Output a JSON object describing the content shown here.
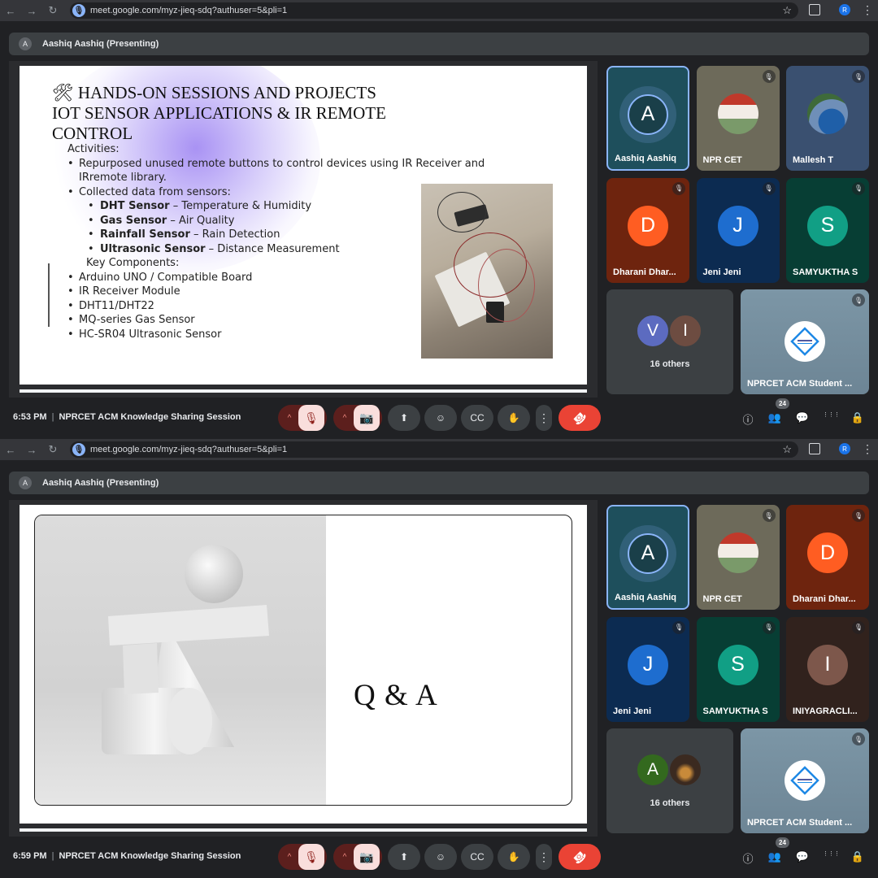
{
  "browser": {
    "url": "meet.google.com/myz-jieq-sdq?authuser=5&pli=1",
    "profile_initial": "R",
    "back_glyph": "←",
    "forward_glyph": "→",
    "reload_glyph": "↻",
    "star_glyph": "☆",
    "kebab_glyph": "⋮"
  },
  "presenter": {
    "initial": "A",
    "label": "Aashiq Aashiq (Presenting)"
  },
  "meeting": {
    "name": "NPRCET ACM Knowledge Sharing Session",
    "separator": "|",
    "participant_count": "24"
  },
  "screens": [
    {
      "time": "6:53 PM",
      "slide": {
        "title_lines": [
          "🛠 HANDS-ON SESSIONS AND PROJECTS",
          "IOT SENSOR APPLICATIONS & IR REMOTE",
          "CONTROL"
        ],
        "activities_heading": "Activities:",
        "activity_1": "Repurposed unused remote buttons to control devices using IR Receiver and IRremote library.",
        "activity_2": "Collected data from sensors:",
        "sensors": [
          {
            "name": "DHT Sensor",
            "desc": " – Temperature & Humidity"
          },
          {
            "name": "Gas Sensor",
            "desc": " – Air Quality"
          },
          {
            "name": "Rainfall Sensor",
            "desc": " – Rain Detection"
          },
          {
            "name": "Ultrasonic Sensor",
            "desc": " – Distance Measurement"
          }
        ],
        "components_heading": "Key Components:",
        "components": [
          "Arduino UNO / Compatible Board",
          "IR Receiver Module",
          "DHT11/DHT22",
          "MQ-series Gas Sensor",
          "HC-SR04 Ultrasonic Sensor"
        ]
      },
      "tiles": [
        {
          "name": "Aashiq Aashiq",
          "initial": "A",
          "color": "#1e4f5c",
          "speaking": true,
          "muted": false
        },
        {
          "name": "NPR CET",
          "initial": "",
          "color": "#6d6a5a",
          "speaking": false,
          "muted": true
        },
        {
          "name": "Mallesh T",
          "initial": "",
          "color": "#3a5070",
          "speaking": false,
          "muted": true
        },
        {
          "name": "Dharani Dhar...",
          "initial": "D",
          "color": "#f4511e",
          "speaking": false,
          "muted": true
        },
        {
          "name": "Jeni Jeni",
          "initial": "J",
          "color": "#1a5fb4",
          "speaking": false,
          "muted": true
        },
        {
          "name": "SAMYUKTHA S",
          "initial": "S",
          "color": "#0f8a74",
          "speaking": false,
          "muted": true
        }
      ],
      "others": {
        "label": "16 others",
        "avatars": [
          {
            "initial": "V",
            "color": "#5c6bc0"
          },
          {
            "initial": "I",
            "color": "#6d4c41"
          }
        ]
      },
      "acm_tile": {
        "name": "NPRCET ACM Student ..."
      }
    },
    {
      "time": "6:59 PM",
      "slide": {
        "qa_text": "Q & A"
      },
      "tiles": [
        {
          "name": "Aashiq Aashiq",
          "initial": "A",
          "color": "#1e4f5c",
          "speaking": true,
          "muted": false
        },
        {
          "name": "NPR CET",
          "initial": "",
          "color": "#6d6a5a",
          "speaking": false,
          "muted": true
        },
        {
          "name": "Dharani Dhar...",
          "initial": "D",
          "color": "#f4511e",
          "speaking": false,
          "muted": true
        },
        {
          "name": "Jeni Jeni",
          "initial": "J",
          "color": "#1a5fb4",
          "speaking": false,
          "muted": true
        },
        {
          "name": "SAMYUKTHA S",
          "initial": "S",
          "color": "#0f8a74",
          "speaking": false,
          "muted": true
        },
        {
          "name": "INIYAGRACLI...",
          "initial": "I",
          "color": "#6d4c41",
          "speaking": false,
          "muted": true
        }
      ],
      "others": {
        "label": "16 others",
        "avatars": [
          {
            "initial": "A",
            "color": "#33691e"
          },
          {
            "initial": "",
            "color": "#3b2a20"
          }
        ]
      },
      "acm_tile": {
        "name": "NPRCET ACM Student ..."
      }
    }
  ],
  "icons": {
    "mic_off": "🎙",
    "camera_off": "📷",
    "present": "⬆",
    "emoji": "☺",
    "captions": "CC",
    "raise_hand": "✋",
    "more": "⋮",
    "end_call": "☎",
    "info": "ⓘ",
    "people": "👥",
    "chat": "💬",
    "activities": "⋮⋮⋮",
    "host_controls": "🔒"
  }
}
